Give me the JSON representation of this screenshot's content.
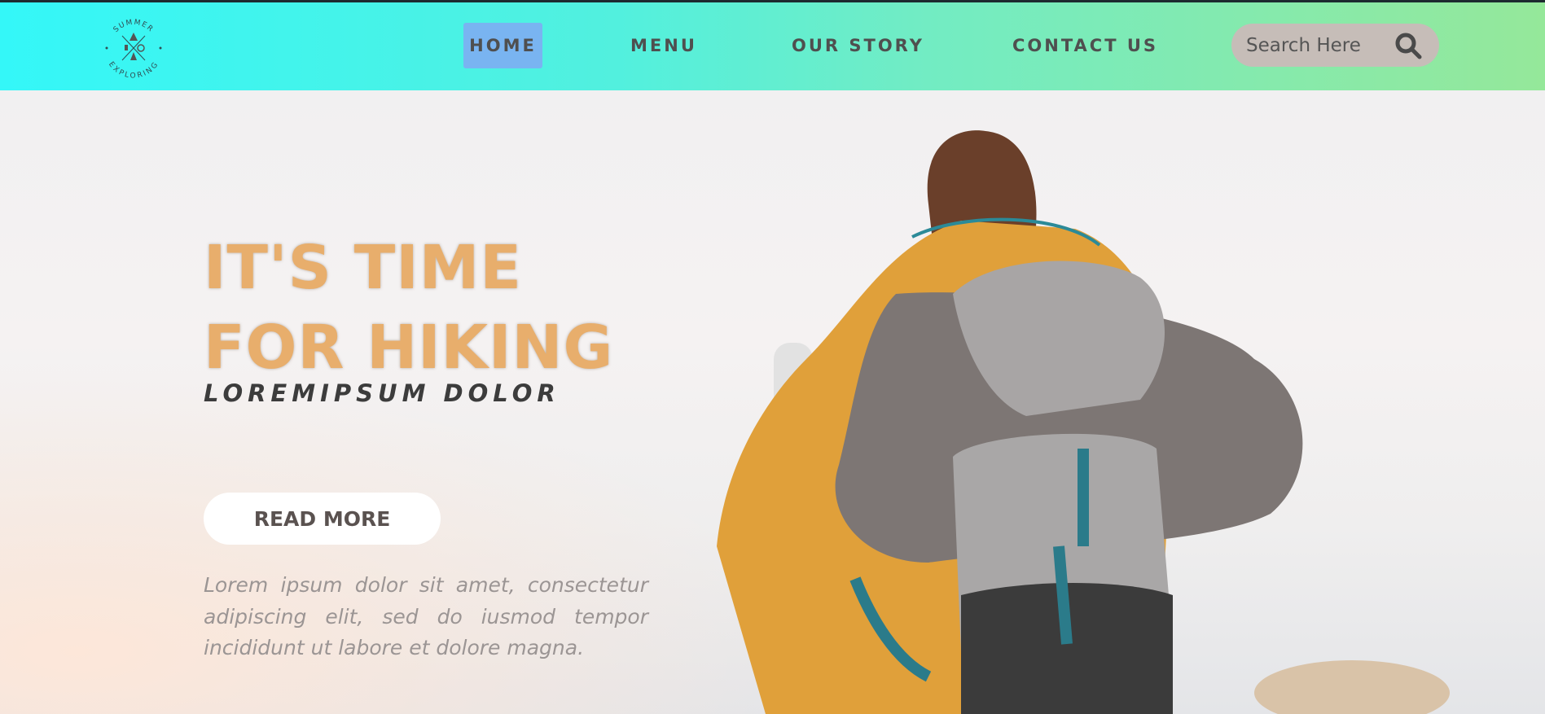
{
  "header": {
    "logo": {
      "top_text": "SUMMER",
      "bottom_text": "EXPLORING"
    },
    "nav": [
      {
        "label": "HOME",
        "active": true
      },
      {
        "label": "MENU"
      },
      {
        "label": "OUR STORY"
      },
      {
        "label": "CONTACT US"
      }
    ],
    "search": {
      "placeholder": "Search Here",
      "icon": "search-icon"
    },
    "colors": {
      "gradient_start": "#34f7f8",
      "gradient_end": "#95e89a",
      "active_nav": "#79b4f1"
    }
  },
  "hero": {
    "title_line1": "IT'S TIME",
    "title_line2": "FOR HIKING",
    "subtitle": "LOREMIPSUM DOLOR",
    "button_label": "READ MORE",
    "paragraph": "Lorem ipsum dolor sit amet, consectetur adipiscing elit, sed do iusmod tempor incididunt ut labore et dolore magna.",
    "title_color": "#e8ae6c"
  }
}
